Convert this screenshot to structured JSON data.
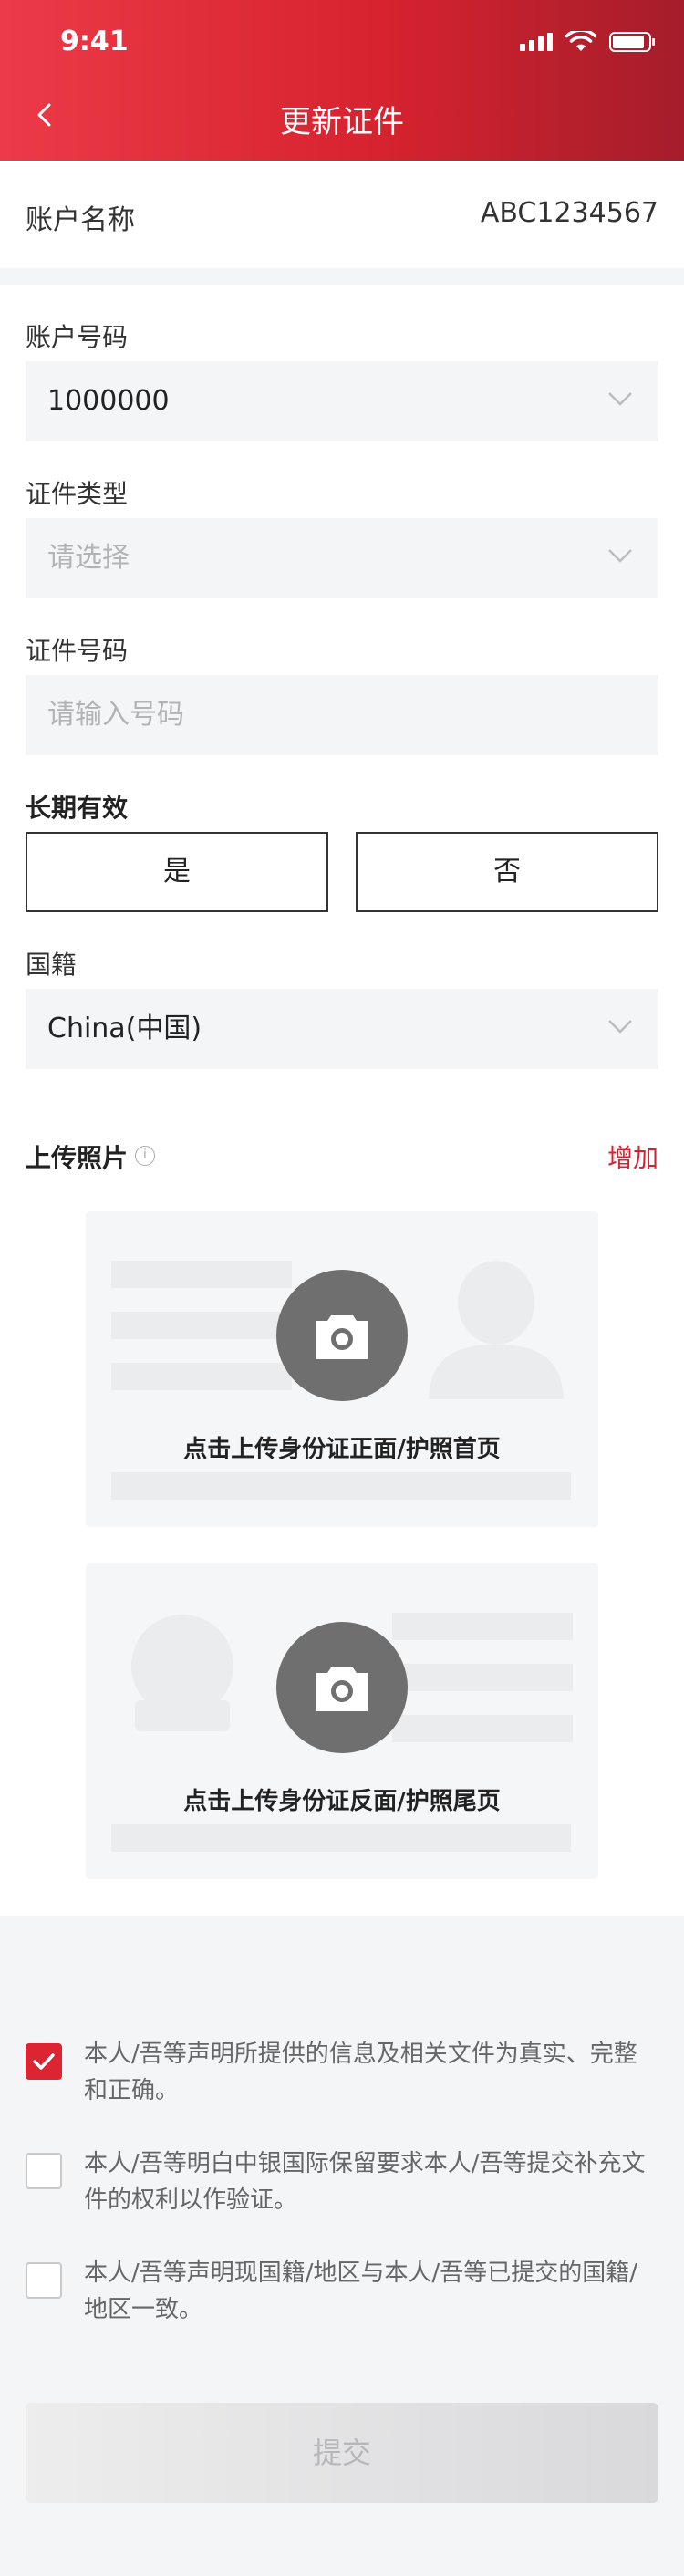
{
  "status_bar": {
    "time": "9:41"
  },
  "nav": {
    "title": "更新证件",
    "back_icon": "chevron-left-icon"
  },
  "account_name": {
    "label": "账户名称",
    "value": "ABC1234567"
  },
  "form": {
    "account_number": {
      "label": "账户号码",
      "value": "1000000"
    },
    "id_type": {
      "label": "证件类型",
      "placeholder": "请选择"
    },
    "id_number": {
      "label": "证件号码",
      "placeholder": "请输入号码"
    },
    "long_term": {
      "label": "长期有效",
      "options": [
        "是",
        "否"
      ]
    },
    "nationality": {
      "label": "国籍",
      "value": "China(中国)"
    },
    "upload": {
      "label": "上传照片",
      "add": "增加",
      "front_text": "点击上传身份证正面/护照首页",
      "back_text": "点击上传身份证反面/护照尾页"
    }
  },
  "declarations": [
    {
      "text": "本人/吾等声明所提供的信息及相关文件为真实、完整和正确。",
      "checked": true
    },
    {
      "text": "本人/吾等明白中银国际保留要求本人/吾等提交补充文件的权利以作验证。",
      "checked": false
    },
    {
      "text": "本人/吾等声明现国籍/地区与本人/吾等已提交的国籍/地区一致。",
      "checked": false
    }
  ],
  "submit": {
    "label": "提交"
  },
  "colors": {
    "brand_red": "#d6222f",
    "checkbox_checked": "#dd2432"
  }
}
